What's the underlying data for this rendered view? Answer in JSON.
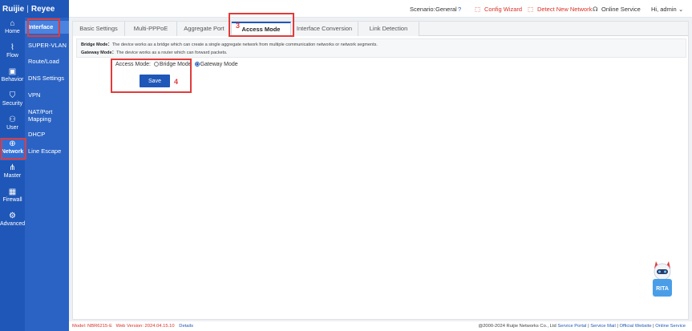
{
  "logo": {
    "brand_left": "Ruijie",
    "brand_right": "Reyee"
  },
  "topbar": {
    "scenario_label": "Scenario:",
    "scenario_value": "General",
    "config_wizard": "Config Wizard",
    "detect_network": "Detect New Network",
    "online_service": "Online Service",
    "user": "Hi, admin"
  },
  "nav": [
    {
      "label": "Home",
      "icon": "⌂"
    },
    {
      "label": "Flow",
      "icon": "⌇"
    },
    {
      "label": "Behavior",
      "icon": "▣"
    },
    {
      "label": "Security",
      "icon": "⛉"
    },
    {
      "label": "User",
      "icon": "⚇"
    },
    {
      "label": "Network",
      "icon": "⊕"
    },
    {
      "label": "Master",
      "icon": "⋔"
    },
    {
      "label": "Firewall",
      "icon": "▦"
    },
    {
      "label": "Advanced",
      "icon": "⚙"
    }
  ],
  "subnav": [
    "Interface",
    "SUPER-VLAN",
    "Route/Load",
    "DNS Settings",
    "VPN",
    "NAT/Port Mapping",
    "DHCP",
    "Line Escape"
  ],
  "tabs": [
    "Basic Settings",
    "Multi-PPPoE",
    "Aggregate Port",
    "Access Mode",
    "Interface Conversion",
    "Link Detection"
  ],
  "info": {
    "bridge_title": "Bridge Mode：",
    "bridge_text": "The device works as a bridge which can create a single aggregate network from multiple communication networks or network segments.",
    "gateway_title": "Gateway Mode：",
    "gateway_text": "The device works as a router which can forward packets."
  },
  "form": {
    "label": "Access Mode:",
    "options": [
      "Bridge Mode",
      "Gateway Mode"
    ],
    "selected": "Gateway Mode",
    "save_label": "Save"
  },
  "annotations": [
    "3",
    "4"
  ],
  "rita_label": "RITA",
  "footer": {
    "model_label": "Model: NBR6215-E",
    "web_version": "Web Version: 2024.04.15.10",
    "details": "Details",
    "copyright": "@2000-2024 Ruijie Networks Co., Ltd",
    "links": [
      "Service Portal",
      "Service Mail",
      "Official Website",
      "Online Service"
    ]
  },
  "colors": {
    "primary": "#1f57b8",
    "annotation": "#e23b3b"
  }
}
